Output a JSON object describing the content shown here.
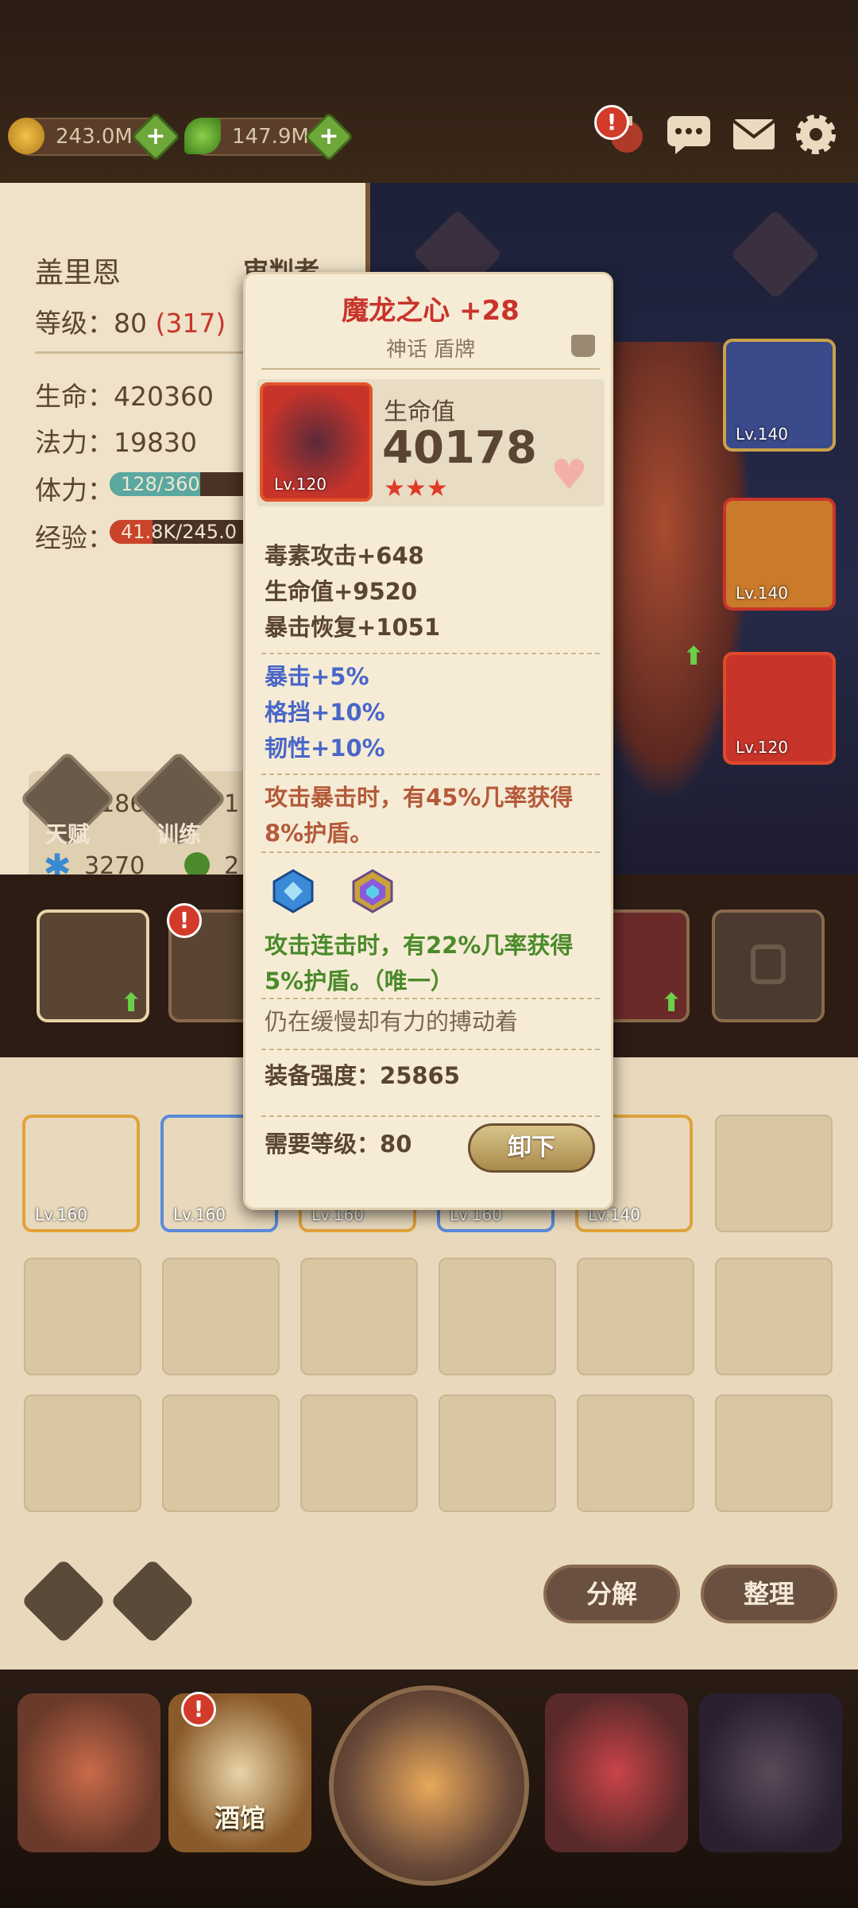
{
  "resources": {
    "gold": "243.0M",
    "gems": "147.9M"
  },
  "hero": {
    "name": "盖里恩",
    "title": "审判者",
    "level_label": "等级：",
    "level": "80",
    "level_extra": "(317)",
    "hp_label": "生命：",
    "hp": "420360",
    "mp_label": "法力：",
    "mp": "19830",
    "stamina_label": "体力：",
    "stamina": "128/360",
    "stamina_fraction": 0.356,
    "exp_label": "经验：",
    "exp": "41.8K/245.0",
    "exp_fraction": 0.17,
    "attr1": "21865",
    "attr2": "1",
    "attr3": "3270",
    "attr4": "2",
    "talent_label": "天赋",
    "train_label": "训练"
  },
  "equip_slots": [
    {
      "level": "Lv.140"
    },
    {
      "level": "Lv.140"
    },
    {
      "level": "Lv.120"
    }
  ],
  "popup": {
    "title": "魔龙之心 +28",
    "subtitle": "神话 盾牌",
    "item_level": "Lv.120",
    "main_stat_label": "生命值",
    "main_stat_value": "40178",
    "stars": "★★★",
    "base_stats": [
      "毒素攻击+648",
      "生命值+9520",
      "暴击恢复+1051"
    ],
    "bonus_stats": [
      "暴击+5%",
      "格挡+10%",
      "韧性+10%"
    ],
    "special_effect": "攻击暴击时，有45%几率获得8%护盾。",
    "gem_effect": "攻击连击时，有22%几率获得5%护盾。（唯一）",
    "flavor": "仍在缓慢却有力的搏动着",
    "power_label": "装备强度：",
    "power": "25865",
    "req_label": "需要等级：",
    "req_level": "80",
    "unequip_label": "卸下"
  },
  "inventory": {
    "items": [
      {
        "level": "Lv.160",
        "color": "#c97a2a"
      },
      {
        "level": "Lv.160",
        "color": "#3a6ab8"
      },
      {
        "level": "Lv.160",
        "color": "#c97a2a"
      },
      {
        "level": "Lv.160",
        "color": "#3a6ab8"
      },
      {
        "level": "Lv.140",
        "color": "#c97a2a"
      }
    ],
    "decompose_label": "分解",
    "sort_label": "整理"
  },
  "nav": {
    "tavern_label": "酒馆"
  },
  "colors": {
    "accent_red": "#c9342a",
    "panel": "#efe2c8",
    "popup": "#f6ecd6"
  }
}
